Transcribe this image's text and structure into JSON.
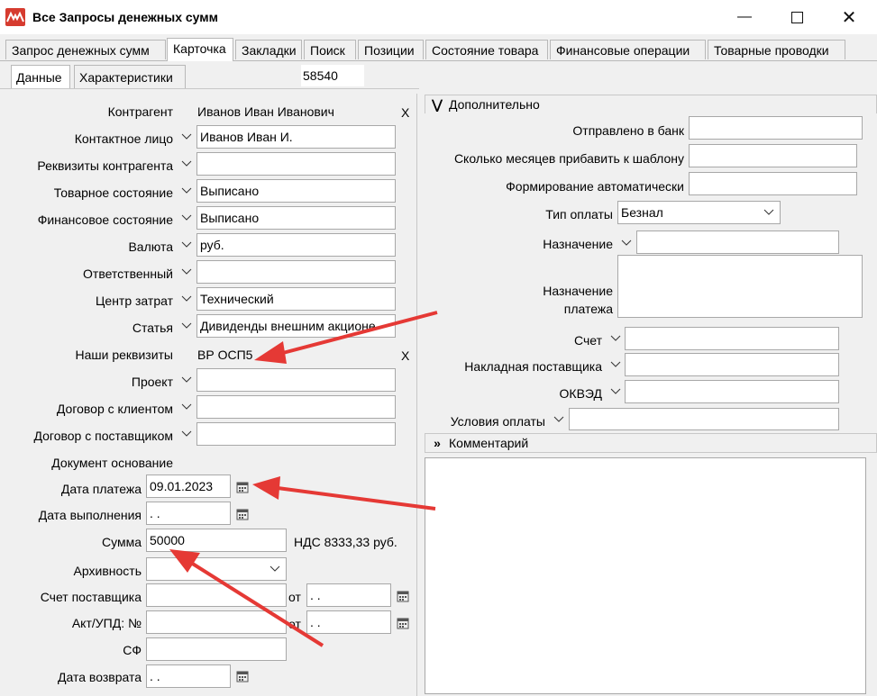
{
  "window": {
    "title": "Все Запросы денежных сумм"
  },
  "tabs": [
    "Запрос денежных сумм",
    "Карточка",
    "Закладки",
    "Поиск",
    "Позиции",
    "Состояние товара",
    "Финансовые операции",
    "Товарные проводки"
  ],
  "subtabs": [
    "Данные",
    "Характеристики"
  ],
  "record_number": "58540",
  "form": {
    "counterparty_label": "Контрагент",
    "counterparty_value": "Иванов Иван Иванович",
    "contact_label": "Контактное лицо",
    "contact_value": "Иванов Иван И.",
    "requisites_label": "Реквизиты контрагента",
    "requisites_value": "",
    "goods_state_label": "Товарное состояние",
    "goods_state_value": "Выписано",
    "fin_state_label": "Финансовое состояние",
    "fin_state_value": "Выписано",
    "currency_label": "Валюта",
    "currency_value": "руб.",
    "responsible_label": "Ответственный",
    "responsible_value": "",
    "cost_center_label": "Центр затрат",
    "cost_center_value": "Технический",
    "article_label": "Статья",
    "article_value": "Дивиденды внешним акционе",
    "our_req_label": "Наши реквизиты",
    "our_req_value": "ВР ОСП5",
    "project_label": "Проект",
    "client_contract_label": "Договор с клиентом",
    "supplier_contract_label": "Договор с поставщиком",
    "base_doc_label": "Документ основание",
    "pay_date_label": "Дата платежа",
    "pay_date_value": "09.01.2023",
    "exec_date_label": "Дата выполнения",
    "exec_date_value": " .  .",
    "sum_label": "Сумма",
    "sum_value": "50000",
    "vat_text": "НДС 8333,33 руб.",
    "archive_label": "Архивность",
    "supplier_invoice_label": "Счет поставщика",
    "act_label": "Акт/УПД: №",
    "from_label": "от",
    "date_empty": " .  .",
    "sf_label": "СФ",
    "return_date_label": "Дата возврата",
    "close_x": "X"
  },
  "extra": {
    "header": "Дополнительно",
    "sent_bank_label": "Отправлено в банк",
    "months_label": "Сколько месяцев прибавить к шаблону",
    "auto_label": "Формирование автоматически",
    "pay_type_label": "Тип оплаты",
    "pay_type_value": "Безнал",
    "purpose_label": "Назначение",
    "pay_purpose_label_1": "Назначение",
    "pay_purpose_label_2": "платежа",
    "account_label": "Счет",
    "supplier_waybill_label": "Накладная поставщика",
    "okved_label": "ОКВЭД",
    "pay_terms_label": "Условия оплаты"
  },
  "comment": {
    "header": "Комментарий"
  },
  "colors": {
    "arrow": "#e53935",
    "app_icon": "#d63b2f"
  }
}
